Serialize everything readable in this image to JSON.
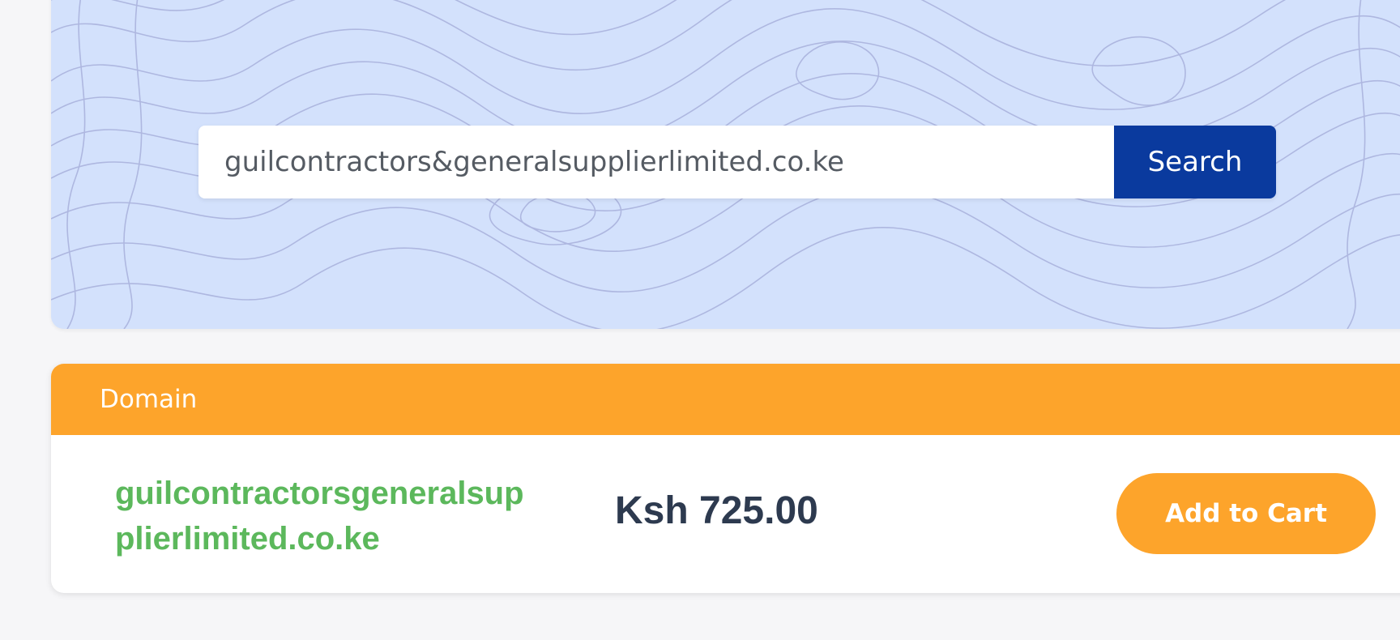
{
  "search": {
    "value": "guilcontractors&generalsupplierlimited.co.ke",
    "button_label": "Search"
  },
  "results": {
    "header_label": "Domain",
    "item": {
      "domain": "guilcontractorsgeneralsupplierlimited.co.ke",
      "price": "Ksh 725.00",
      "cart_label": "Add to Cart"
    }
  },
  "colors": {
    "hero_background": "#d3e1fc",
    "search_button": "#0a3a9e",
    "accent_orange": "#fda42b",
    "domain_green": "#5cb85c",
    "price_dark": "#2d3a4f"
  }
}
